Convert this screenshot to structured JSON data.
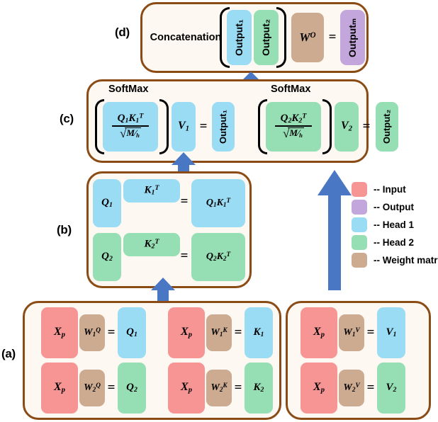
{
  "figure": {
    "panels": [
      {
        "id": "a",
        "label": "(a)"
      },
      {
        "id": "b",
        "label": "(b)"
      },
      {
        "id": "c",
        "label": "(c)"
      },
      {
        "id": "d",
        "label": "(d)"
      }
    ]
  },
  "panel_a": {
    "group_q": {
      "rows": [
        {
          "input": "X<sub>p</sub>",
          "weight": "W<sub>1</sub><sup>Q</sup>",
          "eq": "=",
          "result": "Q<sub>1</sub>"
        },
        {
          "input": "X<sub>p</sub>",
          "weight": "W<sub>2</sub><sup>Q</sup>",
          "eq": "=",
          "result": "Q<sub>2</sub>"
        }
      ]
    },
    "group_k": {
      "rows": [
        {
          "input": "X<sub>p</sub>",
          "weight": "W<sub>1</sub><sup>K</sup>",
          "eq": "=",
          "result": "K<sub>1</sub>"
        },
        {
          "input": "X<sub>p</sub>",
          "weight": "W<sub>2</sub><sup>K</sup>",
          "eq": "=",
          "result": "K<sub>2</sub>"
        }
      ]
    },
    "group_v": {
      "rows": [
        {
          "input": "X<sub>p</sub>",
          "weight": "W<sub>1</sub><sup>V</sup>",
          "eq": "=",
          "result": "V<sub>1</sub>"
        },
        {
          "input": "X<sub>p</sub>",
          "weight": "W<sub>2</sub><sup>V</sup>",
          "eq": "=",
          "result": "V<sub>2</sub>"
        }
      ]
    }
  },
  "panel_b": {
    "rows": [
      {
        "q": "Q<sub>1</sub>",
        "kt": "K<sub>1</sub><sup>T</sup>",
        "eq": "=",
        "result": "Q<sub>1</sub>K<sub>1</sub><sup>T</sup>"
      },
      {
        "q": "Q<sub>2</sub>",
        "kt": "K<sub>2</sub><sup>T</sup>",
        "eq": "=",
        "result": "Q<sub>2</sub>K<sub>2</sub><sup>T</sup>"
      }
    ]
  },
  "panel_c": {
    "head1": {
      "softmax_label": "SoftMax",
      "numerator": "Q<sub>1</sub>K<sub>1</sub><sup>T</sup>",
      "denominator_radical": "√",
      "denominator_inner": "M⁄<sub>h</sub>",
      "v": "V<sub>1</sub>",
      "eq": "=",
      "output": "Output₁"
    },
    "head2": {
      "softmax_label": "SoftMax",
      "numerator": "Q<sub>2</sub>K<sub>2</sub><sup>T</sup>",
      "denominator_radical": "√",
      "denominator_inner": "M⁄<sub>h</sub>",
      "v": "V<sub>2</sub>",
      "eq": "=",
      "output": "Output₂"
    }
  },
  "panel_d": {
    "title": "Concatenation",
    "output1": "Output₁",
    "output2": "Output₂",
    "weight": "W<sup>O</sup>",
    "eq": "=",
    "final_output": "Outputₘ"
  },
  "legend": {
    "items": [
      {
        "color": "#f79494",
        "label": "-- Input",
        "name": "input"
      },
      {
        "color": "#c3a6db",
        "label": "-- Output",
        "name": "output"
      },
      {
        "color": "#9bdcf5",
        "label": "-- Head 1",
        "name": "head-1"
      },
      {
        "color": "#96dfb4",
        "label": "-- Head 2",
        "name": "head-2"
      },
      {
        "color": "#cdab91",
        "label": "-- Weight matrix",
        "name": "weight-matrix"
      }
    ]
  },
  "colors": {
    "panel_border": "#8a4b15",
    "panel_fill": "#fdf8f2",
    "arrow": "#4a77c4",
    "input": "#f79494",
    "output": "#c3a6db",
    "head1": "#9bdcf5",
    "head2": "#96dfb4",
    "weight": "#cdab91"
  }
}
